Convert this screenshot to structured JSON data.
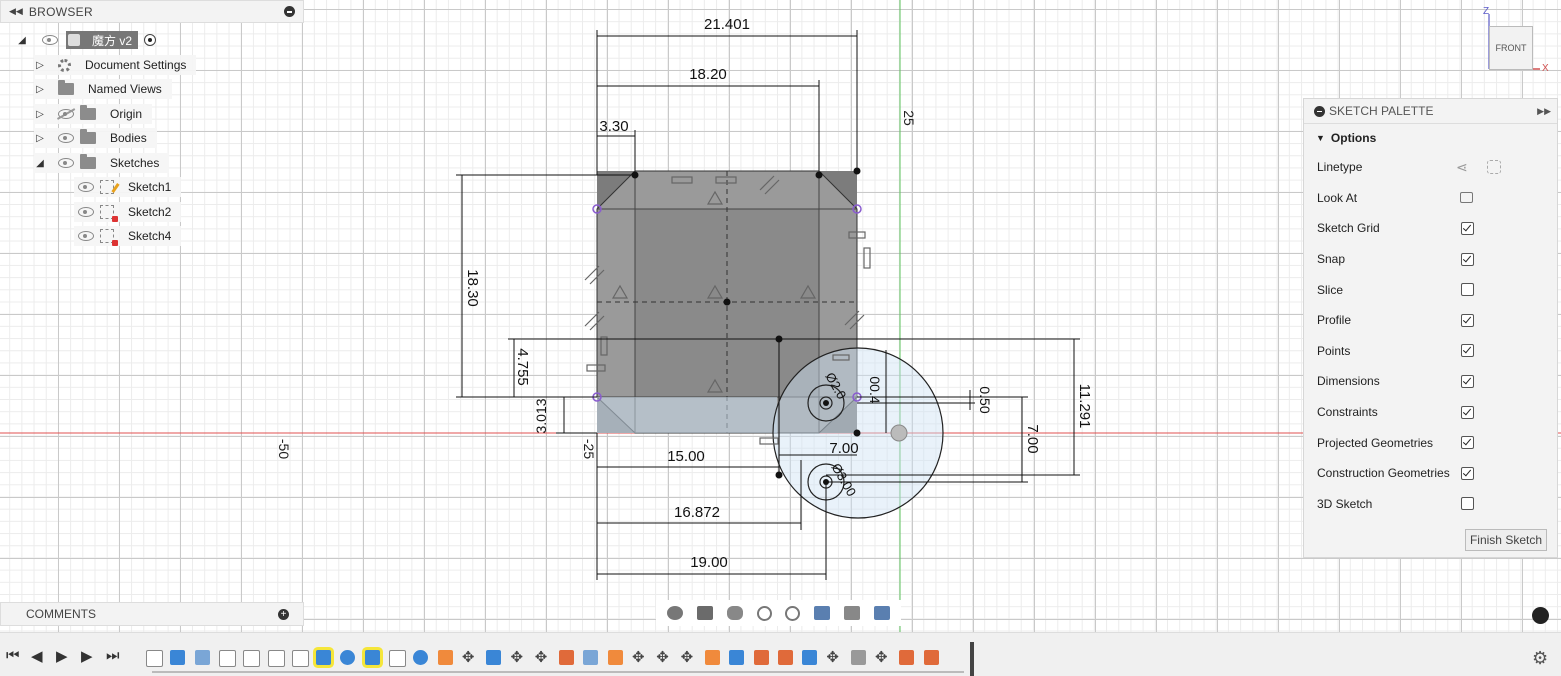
{
  "browser": {
    "title": "BROWSER",
    "root": "魔方 v2",
    "items": [
      {
        "label": "Document Settings"
      },
      {
        "label": "Named Views"
      },
      {
        "label": "Origin"
      },
      {
        "label": "Bodies"
      },
      {
        "label": "Sketches"
      }
    ],
    "sketches": [
      "Sketch1",
      "Sketch2",
      "Sketch4"
    ]
  },
  "comments": {
    "title": "COMMENTS"
  },
  "palette": {
    "title": "SKETCH PALETTE",
    "section": "Options",
    "rows": [
      {
        "label": "Linetype",
        "kind": "icons"
      },
      {
        "label": "Look At",
        "kind": "icon"
      },
      {
        "label": "Sketch Grid",
        "checked": true
      },
      {
        "label": "Snap",
        "checked": true
      },
      {
        "label": "Slice",
        "checked": false
      },
      {
        "label": "Profile",
        "checked": true
      },
      {
        "label": "Points",
        "checked": true
      },
      {
        "label": "Dimensions",
        "checked": true
      },
      {
        "label": "Constraints",
        "checked": true
      },
      {
        "label": "Projected Geometries",
        "checked": true
      },
      {
        "label": "Construction Geometries",
        "checked": true
      },
      {
        "label": "3D Sketch",
        "checked": false
      }
    ],
    "finish": "Finish Sketch"
  },
  "viewcube": {
    "face": "FRONT",
    "z": "Z",
    "x": "X"
  },
  "axis_labels": {
    "top": "25",
    "left": "-50",
    "mid": "-25"
  },
  "dimensions": {
    "d1": "21.401",
    "d2": "18.20",
    "d3": "3.30",
    "d4": "18.30",
    "d5": "4.755",
    "d6": "3.013",
    "d7": "15.00",
    "d8": "16.872",
    "d9": "19.00",
    "d10": "7.00",
    "d11": "11.291",
    "d12": "7.00",
    "d13": "0.50",
    "d14": "00.4",
    "d15": "Ø2.0",
    "d16": "Ø3.00"
  },
  "colors": {
    "body_fill": "#7c7c7c",
    "profile_blue": "#cfe3f5",
    "x_axis": "#e05050",
    "y_axis": "#5bc05b",
    "constraint_point": "#8a5cd0"
  },
  "timeline": {
    "controls": [
      "first-icon",
      "prev-icon",
      "play-icon",
      "next-icon",
      "last-icon"
    ]
  }
}
